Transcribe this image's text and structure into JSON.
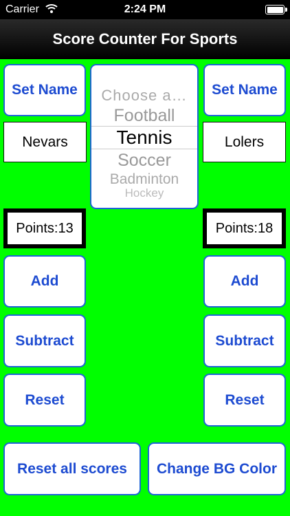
{
  "status_bar": {
    "carrier": "Carrier",
    "time": "2:24 PM"
  },
  "nav": {
    "title": "Score Counter For Sports"
  },
  "picker": {
    "options": [
      "Choose a…",
      "Football",
      "Tennis",
      "Soccer",
      "Badminton",
      "Hockey"
    ],
    "selected": "Tennis"
  },
  "left_team": {
    "set_name_label": "Set Name",
    "name": "Nevars",
    "points_text": "Points:13",
    "add_label": "Add",
    "subtract_label": "Subtract",
    "reset_label": "Reset"
  },
  "right_team": {
    "set_name_label": "Set Name",
    "name": "Lolers",
    "points_text": "Points:18",
    "add_label": "Add",
    "subtract_label": "Subtract",
    "reset_label": "Reset"
  },
  "bottom": {
    "reset_all_label": "Reset all scores",
    "change_bg_label": "Change BG Color"
  },
  "colors": {
    "background": "#00ff00",
    "button_text": "#1d4bd1",
    "button_border": "#1d63d6"
  }
}
